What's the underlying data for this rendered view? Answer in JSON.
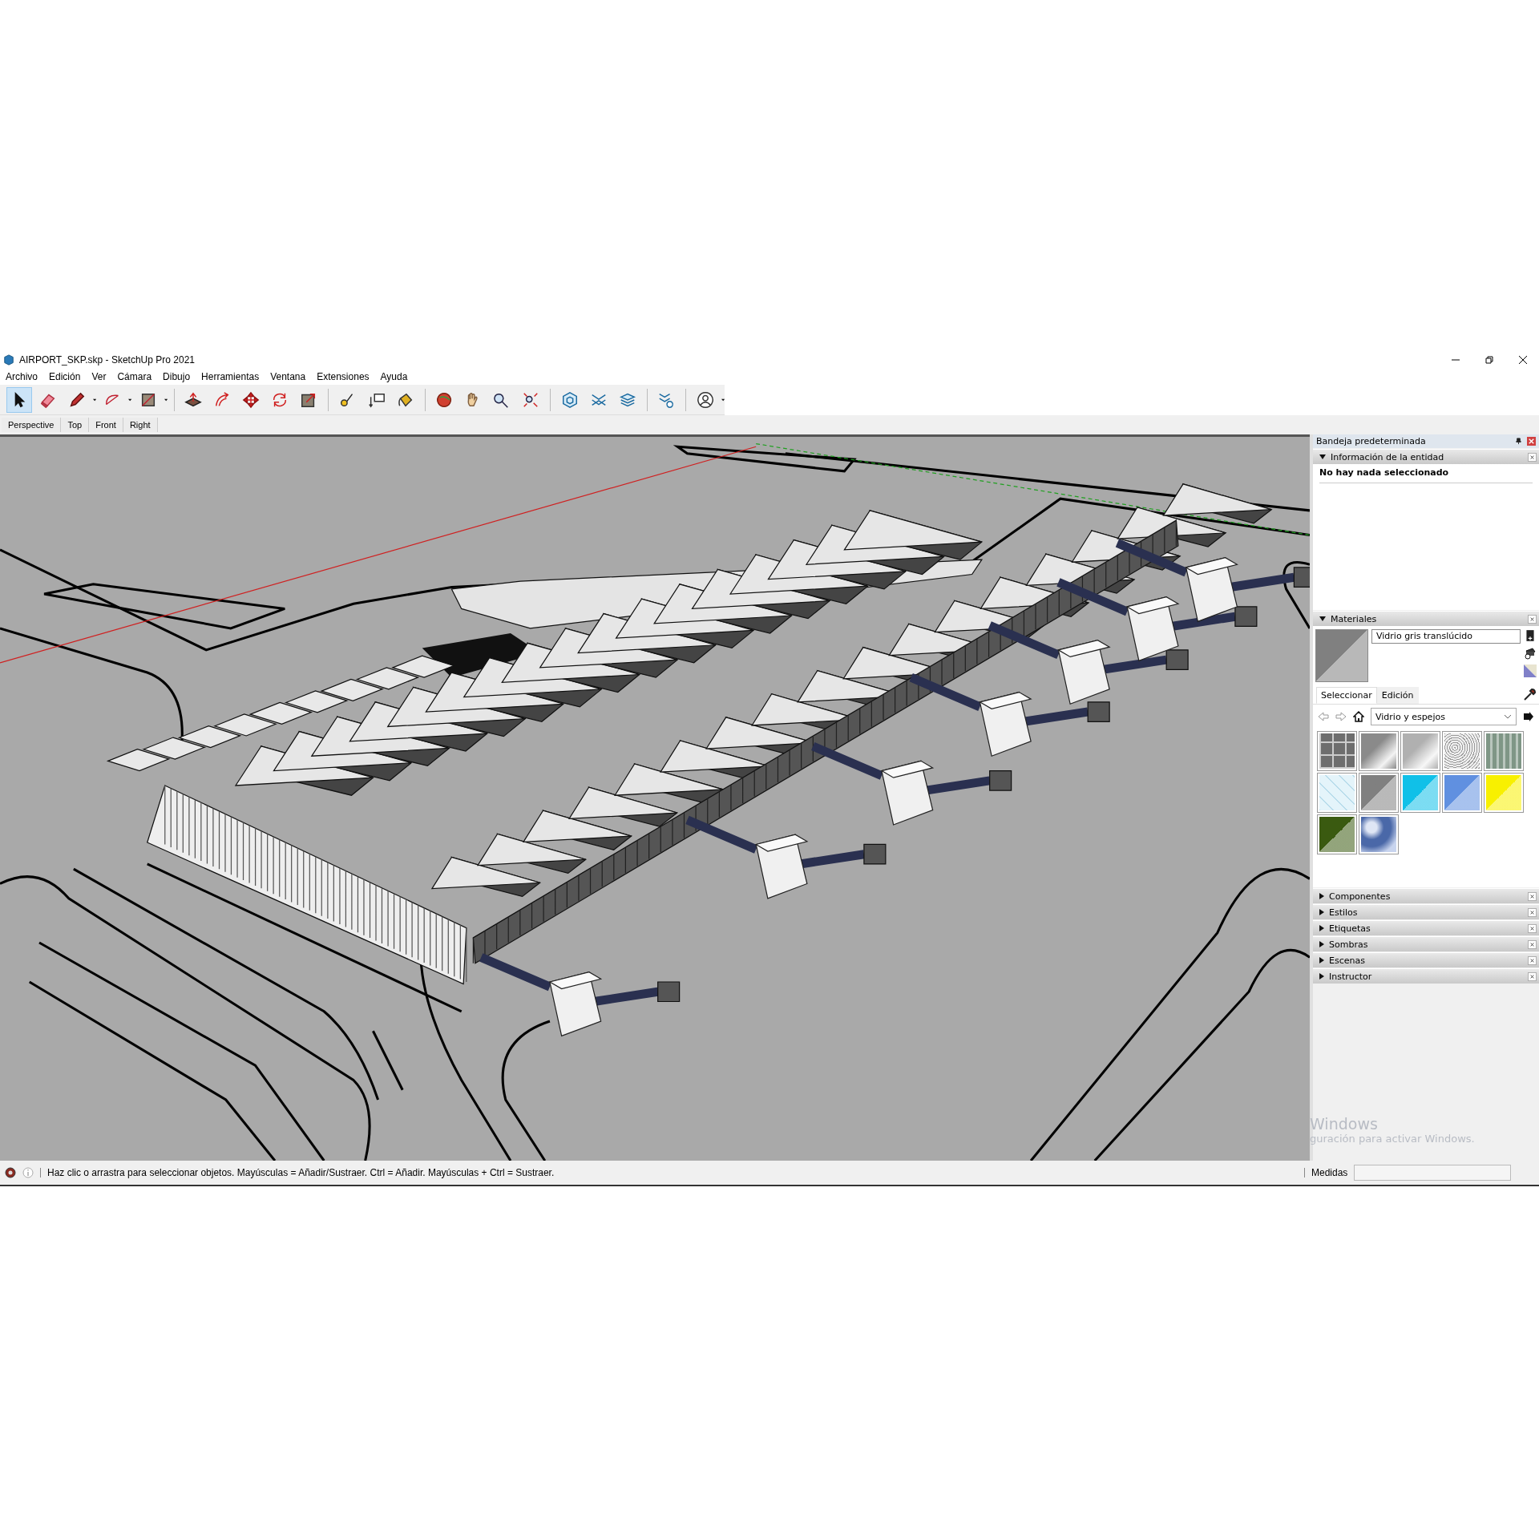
{
  "window": {
    "title": "AIRPORT_SKP.skp - SketchUp Pro 2021"
  },
  "menu": [
    "Archivo",
    "Edición",
    "Ver",
    "Cámara",
    "Dibujo",
    "Herramientas",
    "Ventana",
    "Extensiones",
    "Ayuda"
  ],
  "toolbar": {
    "groups": [
      {
        "tools": [
          {
            "kind": "select",
            "selected": true,
            "dropdown": false
          },
          {
            "kind": "eraser",
            "selected": false,
            "dropdown": false
          },
          {
            "kind": "pencil",
            "selected": false,
            "dropdown": true
          },
          {
            "kind": "arc",
            "selected": false,
            "dropdown": true
          },
          {
            "kind": "rectangle",
            "selected": false,
            "dropdown": true
          }
        ]
      },
      {
        "tools": [
          {
            "kind": "pushpull",
            "selected": false,
            "dropdown": false
          },
          {
            "kind": "followme",
            "selected": false,
            "dropdown": false
          },
          {
            "kind": "move",
            "selected": false,
            "dropdown": false
          },
          {
            "kind": "rotate",
            "selected": false,
            "dropdown": false
          },
          {
            "kind": "scale",
            "selected": false,
            "dropdown": false
          }
        ]
      },
      {
        "tools": [
          {
            "kind": "tape",
            "selected": false,
            "dropdown": false
          },
          {
            "kind": "text",
            "selected": false,
            "dropdown": false
          },
          {
            "kind": "paint",
            "selected": false,
            "dropdown": false
          }
        ]
      },
      {
        "tools": [
          {
            "kind": "orbit",
            "selected": false,
            "dropdown": false
          },
          {
            "kind": "pan",
            "selected": false,
            "dropdown": false
          },
          {
            "kind": "zoom",
            "selected": false,
            "dropdown": false
          },
          {
            "kind": "extents",
            "selected": false,
            "dropdown": false
          }
        ]
      },
      {
        "tools": [
          {
            "kind": "warehouse",
            "selected": false,
            "dropdown": false
          },
          {
            "kind": "layers",
            "selected": false,
            "dropdown": false
          },
          {
            "kind": "stack",
            "selected": false,
            "dropdown": false
          }
        ]
      },
      {
        "tools": [
          {
            "kind": "extension",
            "selected": false,
            "dropdown": false
          }
        ]
      },
      {
        "tools": [
          {
            "kind": "account",
            "selected": false,
            "dropdown": true
          }
        ]
      }
    ]
  },
  "scene_tabs": [
    "Perspective",
    "Top",
    "Front",
    "Right"
  ],
  "tray": {
    "title": "Bandeja predeterminada",
    "entity_info": {
      "title": "Información de la entidad",
      "expanded": true,
      "message": "No hay nada seleccionado"
    },
    "materials": {
      "title": "Materiales",
      "expanded": true,
      "material_name": "Vidrio gris translúcido",
      "tabs": [
        {
          "label": "Seleccionar",
          "selected": true
        },
        {
          "label": "Edición",
          "selected": false
        }
      ],
      "library": "Vidrio y espejos",
      "swatches": [
        {
          "kind": "tiles",
          "color": "#6e6e6e"
        },
        {
          "kind": "gradient",
          "color": "#8a8a8a"
        },
        {
          "kind": "gradient",
          "color": "#b0b0b0"
        },
        {
          "kind": "noise",
          "color": "#9a9a9a"
        },
        {
          "kind": "stripes",
          "color": "#7f9686"
        },
        {
          "kind": "grid",
          "color": "#e4f4fa"
        },
        {
          "kind": "split",
          "color": "#808080"
        },
        {
          "kind": "split",
          "color": "#10c0e8"
        },
        {
          "kind": "split",
          "color": "#6090e0"
        },
        {
          "kind": "split",
          "color": "#f8f000"
        },
        {
          "kind": "split",
          "color": "#3a5a10"
        },
        {
          "kind": "clouds",
          "color": "#4a68a8"
        }
      ]
    },
    "collapsed": [
      {
        "title": "Componentes",
        "expanded": false
      },
      {
        "title": "Estilos",
        "expanded": false
      },
      {
        "title": "Etiquetas",
        "expanded": false
      },
      {
        "title": "Sombras",
        "expanded": false
      },
      {
        "title": "Escenas",
        "expanded": false
      },
      {
        "title": "Instructor",
        "expanded": false
      }
    ]
  },
  "activation_notice": [
    "Windows",
    "guración para activar Windows."
  ],
  "status_bar": {
    "message": "Haz clic o arrastra para seleccionar objetos. Mayúsculas = Añadir/Sustraer. Ctrl = Añadir. Mayúsculas + Ctrl = Sustraer.",
    "measurements_label": "Medidas"
  }
}
